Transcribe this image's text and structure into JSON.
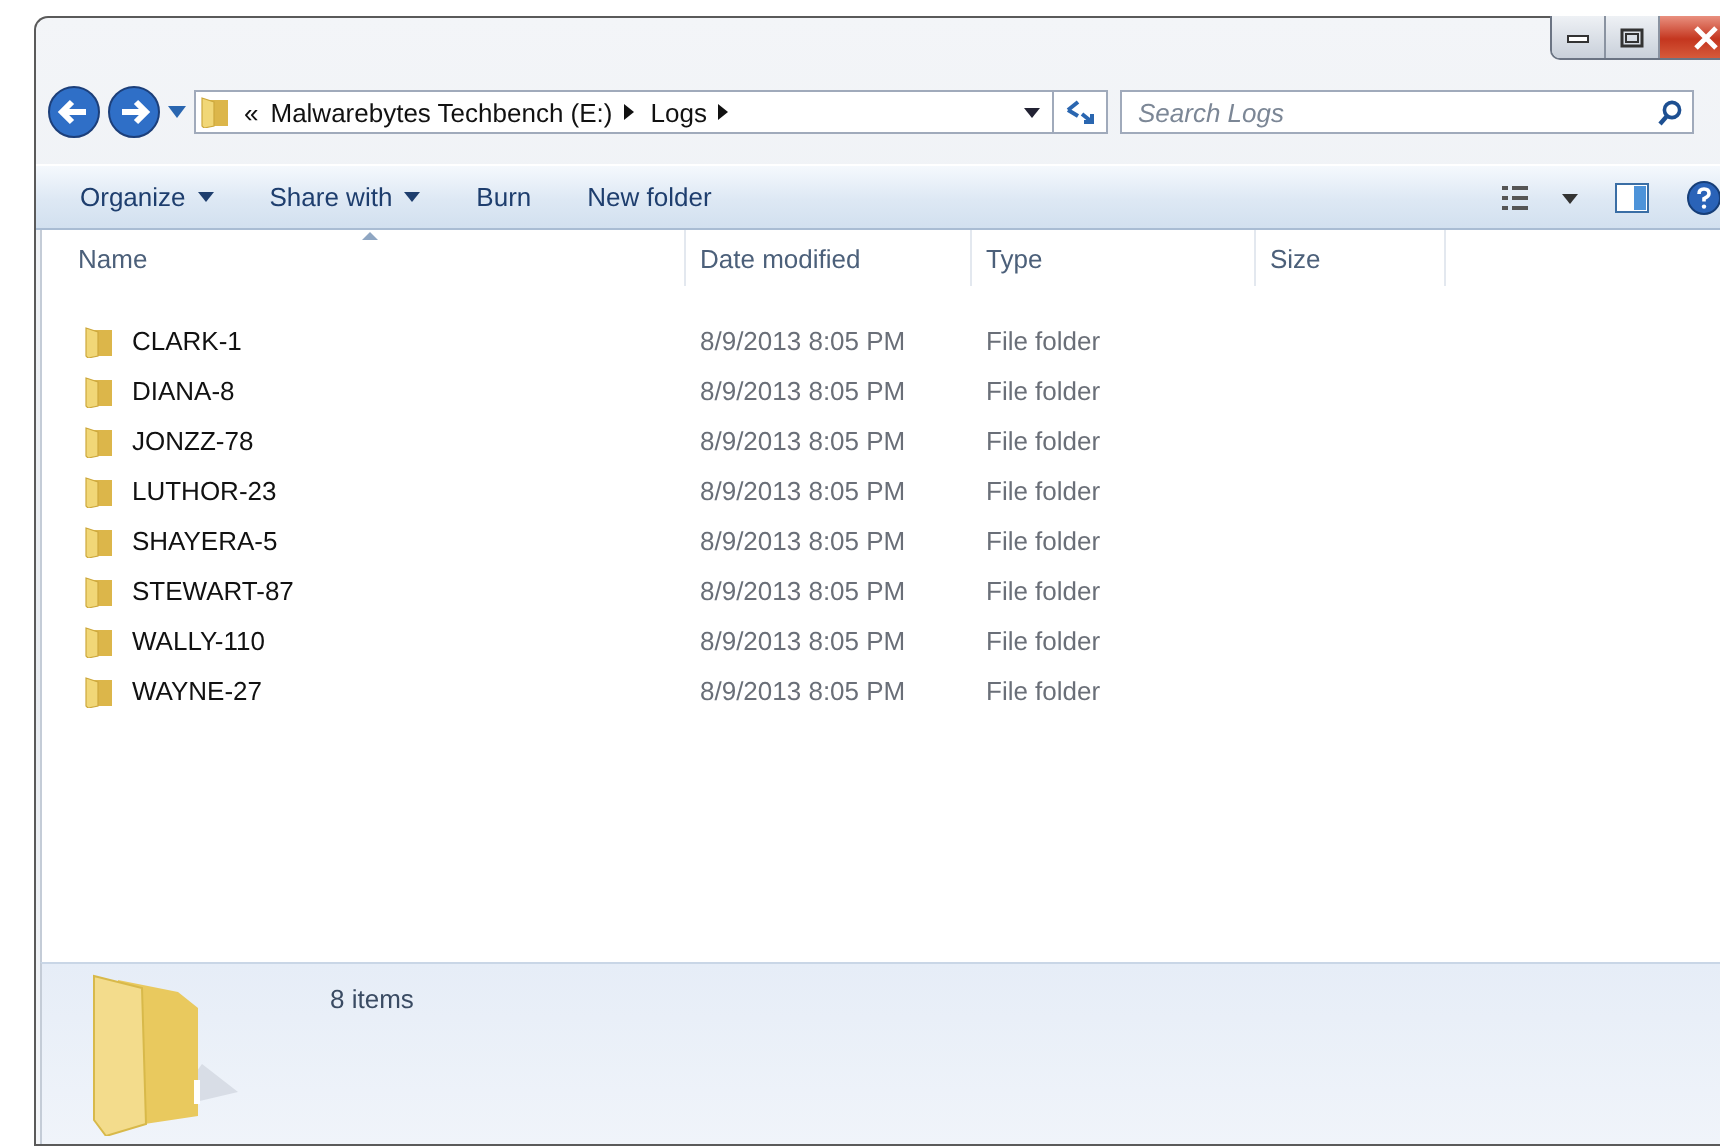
{
  "address_bar": {
    "overflow": "«",
    "path": [
      "Malwarebytes Techbench (E:)",
      "Logs"
    ]
  },
  "search": {
    "placeholder": "Search Logs"
  },
  "toolbar": [
    {
      "label": "Organize",
      "dropdown": true
    },
    {
      "label": "Share with",
      "dropdown": true
    },
    {
      "label": "Burn",
      "dropdown": false
    },
    {
      "label": "New folder",
      "dropdown": false
    }
  ],
  "table": {
    "columns": [
      "Name",
      "Date modified",
      "Type",
      "Size"
    ],
    "rows": [
      {
        "name": "CLARK-1",
        "date": "8/9/2013 8:05 PM",
        "type": "File folder"
      },
      {
        "name": "DIANA-8",
        "date": "8/9/2013 8:05 PM",
        "type": "File folder"
      },
      {
        "name": "JONZZ-78",
        "date": "8/9/2013 8:05 PM",
        "type": "File folder"
      },
      {
        "name": "LUTHOR-23",
        "date": "8/9/2013 8:05 PM",
        "type": "File folder"
      },
      {
        "name": "SHAYERA-5",
        "date": "8/9/2013 8:05 PM",
        "type": "File folder"
      },
      {
        "name": "STEWART-87",
        "date": "8/9/2013 8:05 PM",
        "type": "File folder"
      },
      {
        "name": "WALLY-110",
        "date": "8/9/2013 8:05 PM",
        "type": "File folder"
      },
      {
        "name": "WAYNE-27",
        "date": "8/9/2013 8:05 PM",
        "type": "File folder"
      }
    ]
  },
  "details_pane": {
    "summary": "8 items"
  }
}
